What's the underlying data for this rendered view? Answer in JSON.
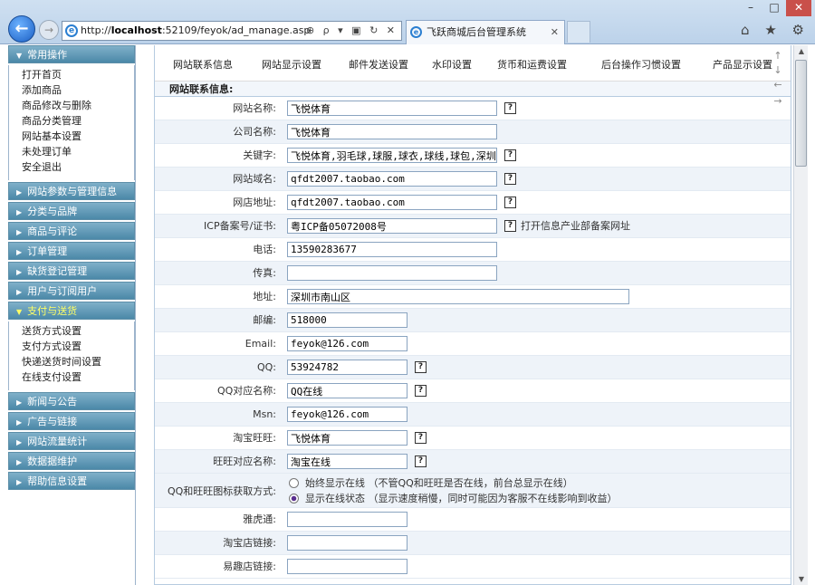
{
  "browser": {
    "url_prefix": "http://",
    "url_host": "localhost",
    "url_rest": ":52109/feyok/ad_manage.asp",
    "tab_title": "飞跃商城后台管理系统",
    "tab_close": "✕",
    "back": "←",
    "forward": "→",
    "ie_glyph": "e",
    "address_tools": "⊕ ρ ▾ ▣ ↻ ✕",
    "right_icons": "⌂ ★ ⚙",
    "min": "–",
    "max": "□",
    "close": "✕"
  },
  "sidebar": {
    "tri_right": "▶",
    "tri_down": "▼",
    "sections": [
      {
        "title": "常用操作",
        "open": true,
        "items": [
          "打开首页",
          "添加商品",
          "商品修改与删除",
          "商品分类管理",
          "网站基本设置",
          "未处理订单",
          "安全退出"
        ]
      },
      {
        "title": "网站参数与管理信息"
      },
      {
        "title": "分类与品牌"
      },
      {
        "title": "商品与评论"
      },
      {
        "title": "订单管理"
      },
      {
        "title": "缺货登记管理"
      },
      {
        "title": "用户与订阅用户"
      },
      {
        "title": "支付与送货",
        "open": true,
        "active": true,
        "items": [
          "送货方式设置",
          "支付方式设置",
          "快递送货时间设置",
          "在线支付设置"
        ]
      },
      {
        "title": "新闻与公告"
      },
      {
        "title": "广告与链接"
      },
      {
        "title": "网站流量统计"
      },
      {
        "title": "数据据维护"
      },
      {
        "title": "帮助信息设置"
      }
    ]
  },
  "tabs": [
    "网站联系信息",
    "网站显示设置",
    "邮件发送设置",
    "水印设置",
    "货币和运费设置",
    "后台操作习惯设置",
    "产品显示设置"
  ],
  "section_title": "网站联系信息:",
  "help_glyph": "?",
  "form": {
    "site_name": {
      "label": "网站名称:",
      "value": "飞悦体育"
    },
    "company": {
      "label": "公司名称:",
      "value": "飞悦体育"
    },
    "keywords": {
      "label": "关键字:",
      "value": "飞悦体育,羽毛球,球服,球衣,球线,球包,深圳"
    },
    "domain": {
      "label": "网站域名:",
      "value": "qfdt2007.taobao.com"
    },
    "shop": {
      "label": "网店地址:",
      "value": "qfdt2007.taobao.com"
    },
    "icp": {
      "label": "ICP备案号/证书:",
      "value": "粤ICP备05072008号",
      "link": "打开信息产业部备案网址"
    },
    "phone": {
      "label": "电话:",
      "value": "13590283677"
    },
    "fax": {
      "label": "传真:",
      "value": ""
    },
    "address": {
      "label": "地址:",
      "value": "深圳市南山区"
    },
    "zip": {
      "label": "邮编:",
      "value": "518000"
    },
    "email": {
      "label": "Email:",
      "value": "feyok@126.com"
    },
    "qq": {
      "label": "QQ:",
      "value": "53924782"
    },
    "qq_name": {
      "label": "QQ对应名称:",
      "value": "QQ在线"
    },
    "msn": {
      "label": "Msn:",
      "value": "feyok@126.com"
    },
    "wangwang": {
      "label": "淘宝旺旺:",
      "value": "飞悦体育"
    },
    "ww_name": {
      "label": "旺旺对应名称:",
      "value": "淘宝在线"
    },
    "icon_mode": {
      "label": "QQ和旺旺图标获取方式:",
      "opt1": "始终显示在线 （不管QQ和旺旺是否在线，前台总显示在线）",
      "opt2": "显示在线状态 （显示速度稍慢，同时可能因为客服不在线影响到收益）",
      "selected": 2
    },
    "yahoo": {
      "label": "雅虎通:",
      "value": ""
    },
    "taobao_link": {
      "label": "淘宝店链接:",
      "value": ""
    },
    "paipai_link": {
      "label": "易趣店链接:",
      "value": ""
    }
  },
  "scroll_glyphs": {
    "up": "↑",
    "down": "↓",
    "left": "←",
    "right": "→",
    "sb_up": "▲",
    "sb_down": "▼"
  }
}
